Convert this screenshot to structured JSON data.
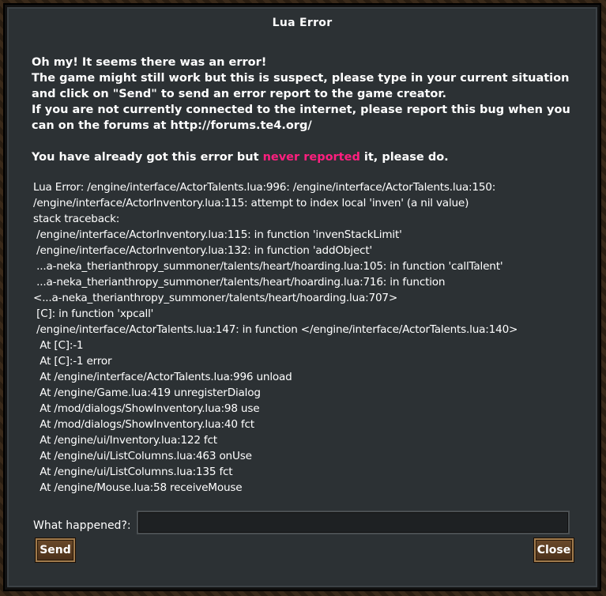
{
  "window": {
    "title": "Lua Error"
  },
  "message": {
    "line1": "Oh my! It seems there was an error!",
    "line2": "The game might still work but this is suspect, please type in your current situation",
    "line3": "and click on \"Send\" to send an error report to the game creator.",
    "line4": "If you are not currently connected to the internet, please report this bug when you",
    "line5": "can on the forums at http://forums.te4.org/",
    "already_prefix": "You have already got this error but ",
    "already_highlight": "never reported",
    "already_suffix": " it, please do.",
    "highlight_color": "#ff1f7f"
  },
  "trace": [
    "Lua Error: /engine/interface/ActorTalents.lua:996: /engine/interface/ActorTalents.lua:150:",
    "/engine/interface/ActorInventory.lua:115: attempt to index local 'inven' (a nil value)",
    "stack traceback:",
    " /engine/interface/ActorInventory.lua:115: in function 'invenStackLimit'",
    " /engine/interface/ActorInventory.lua:132: in function 'addObject'",
    " ...a-neka_therianthropy_summoner/talents/heart/hoarding.lua:105: in function 'callTalent'",
    " ...a-neka_therianthropy_summoner/talents/heart/hoarding.lua:716: in function",
    "<...a-neka_therianthropy_summoner/talents/heart/hoarding.lua:707>",
    " [C]: in function 'xpcall'",
    " /engine/interface/ActorTalents.lua:147: in function </engine/interface/ActorTalents.lua:140>",
    "  At [C]:-1",
    "  At [C]:-1 error",
    "  At /engine/interface/ActorTalents.lua:996 unload",
    "  At /engine/Game.lua:419 unregisterDialog",
    "  At /mod/dialogs/ShowInventory.lua:98 use",
    "  At /mod/dialogs/ShowInventory.lua:40 fct",
    "  At /engine/ui/Inventory.lua:122 fct",
    "  At /engine/ui/ListColumns.lua:463 onUse",
    "  At /engine/ui/ListColumns.lua:135 fct",
    "  At /engine/Mouse.lua:58 receiveMouse"
  ],
  "form": {
    "what_happened_label": "What happened?:",
    "what_happened_value": "",
    "send_label": "Send",
    "close_label": "Close"
  }
}
